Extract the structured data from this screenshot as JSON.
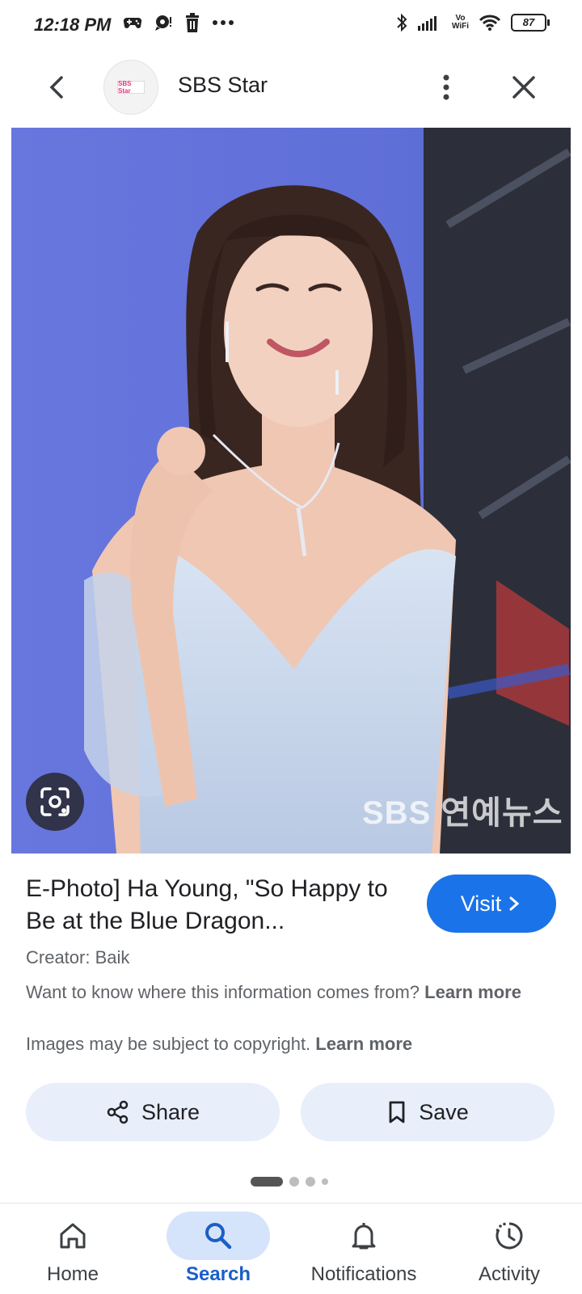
{
  "status_bar": {
    "time": "12:18 PM",
    "battery": "87",
    "vowifi_top": "Vo",
    "vowifi_bottom": "WiFi"
  },
  "header": {
    "site_name": "SBS Star",
    "logo_text": "SBS Star"
  },
  "image": {
    "watermark": "SBS 연예뉴스"
  },
  "details": {
    "title": "E-Photo] Ha Young, \"So Happy to Be at the Blue Dragon...",
    "visit_label": "Visit",
    "creator": "Creator: Baik",
    "info_text": "Want to know where this information comes from? ",
    "info_link": "Learn more",
    "copyright_text": "Images may be subject to copyright. ",
    "copyright_link": "Learn more",
    "share_label": "Share",
    "save_label": "Save"
  },
  "pager": {
    "total": 4,
    "active_index": 0
  },
  "bottom_nav": {
    "items": [
      {
        "label": "Home",
        "icon": "home-icon"
      },
      {
        "label": "Search",
        "icon": "search-icon",
        "active": true
      },
      {
        "label": "Notifications",
        "icon": "bell-icon"
      },
      {
        "label": "Activity",
        "icon": "activity-icon"
      }
    ]
  },
  "colors": {
    "accent": "#1a73e8",
    "chip_bg": "#e8eefa",
    "nav_active_bg": "#d6e4fb",
    "photo_bg": "#6c7ae0"
  }
}
